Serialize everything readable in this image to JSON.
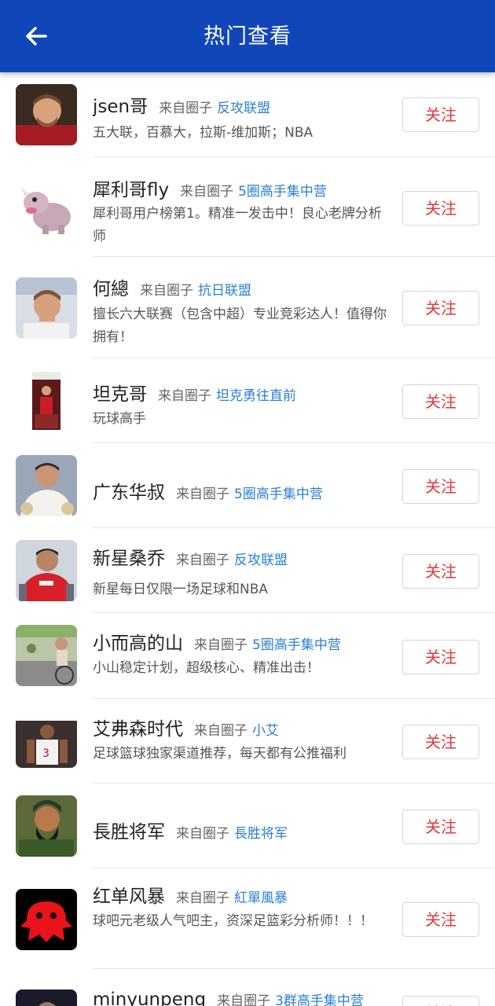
{
  "header": {
    "title": "热门查看"
  },
  "follow_label": "关注",
  "from_label": "来自圈子",
  "items": [
    {
      "name": "jsen哥",
      "circle": "反攻联盟",
      "desc": "五大联，百慕大，拉斯-维加斯；NBA"
    },
    {
      "name": "犀利哥fly",
      "circle": "5圈高手集中营",
      "desc": "犀利哥用户榜第1。精准一发击中！良心老牌分析师"
    },
    {
      "name": "何總",
      "circle": "抗日联盟",
      "desc": "擅长六大联赛（包含中超）专业竞彩达人！值得你拥有！"
    },
    {
      "name": "坦克哥",
      "circle": "坦克勇往直前",
      "desc": "玩球高手"
    },
    {
      "name": "广东华叔",
      "circle": "5圈高手集中营",
      "desc": ""
    },
    {
      "name": "新星桑乔",
      "circle": "反攻联盟",
      "desc": "新星每日仅限一场足球和NBA"
    },
    {
      "name": "小而高的山",
      "circle": "5圈高手集中营",
      "desc": "小山稳定计划，超级核心、精准出击！"
    },
    {
      "name": "艾弗森时代",
      "circle": "小艾",
      "desc": "足球篮球独家渠道推荐，每天都有公推福利"
    },
    {
      "name": "長胜将军",
      "circle": "長胜将军",
      "desc": ""
    },
    {
      "name": "红单风暴",
      "circle": "紅單風暴",
      "desc": "球吧元老级人气吧主，资深足篮彩分析师！！！"
    },
    {
      "name": "minyunpeng",
      "circle": "3群高手集中营",
      "desc": ""
    }
  ]
}
